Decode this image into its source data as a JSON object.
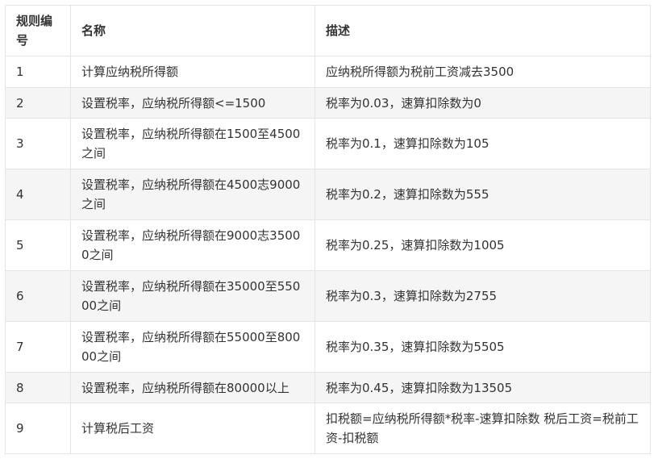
{
  "table": {
    "headers": [
      "规则编号",
      "名称",
      "描述"
    ],
    "rows": [
      {
        "id": "1",
        "name": "计算应纳税所得额",
        "desc": "应纳税所得额为税前工资减去3500"
      },
      {
        "id": "2",
        "name": "设置税率，应纳税所得额<=1500",
        "desc": "税率为0.03，速算扣除数为0"
      },
      {
        "id": "3",
        "name": "设置税率，应纳税所得额在1500至4500之间",
        "desc": "税率为0.1，速算扣除数为105"
      },
      {
        "id": "4",
        "name": "设置税率，应纳税所得额在4500志9000之间",
        "desc": "税率为0.2，速算扣除数为555"
      },
      {
        "id": "5",
        "name": "设置税率，应纳税所得额在9000志35000之间",
        "desc": "税率为0.25，速算扣除数为1005"
      },
      {
        "id": "6",
        "name": "设置税率，应纳税所得额在35000至55000之间",
        "desc": "税率为0.3，速算扣除数为2755"
      },
      {
        "id": "7",
        "name": "设置税率，应纳税所得额在55000至80000之间",
        "desc": "税率为0.35，速算扣除数为5505"
      },
      {
        "id": "8",
        "name": "设置税率，应纳税所得额在80000以上",
        "desc": "税率为0.45，速算扣除数为13505"
      },
      {
        "id": "9",
        "name": "计算税后工资",
        "desc": "扣税额=应纳税所得额*税率-速算扣除数 税后工资=税前工资-扣税额"
      }
    ]
  }
}
